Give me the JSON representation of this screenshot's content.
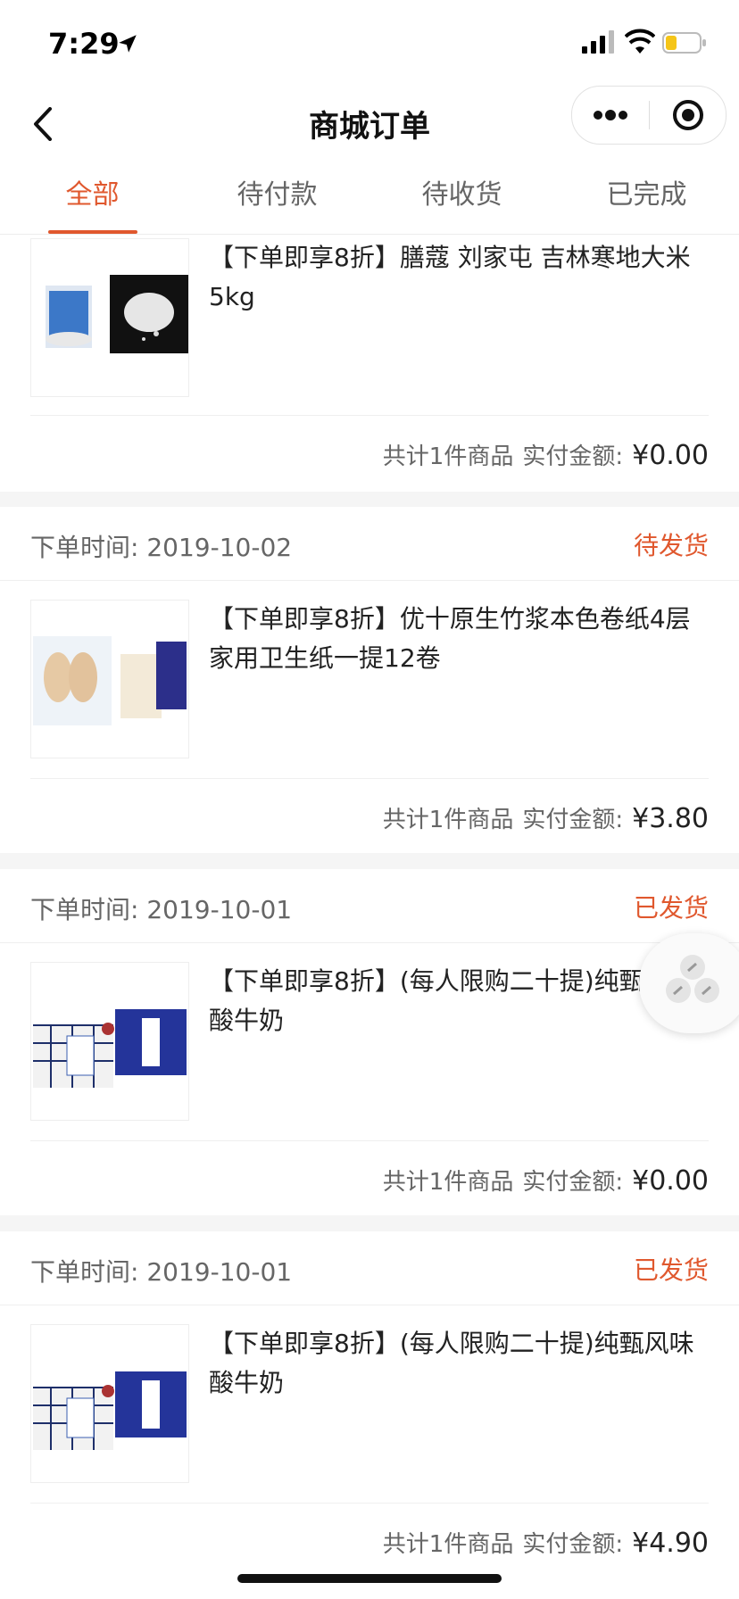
{
  "status": {
    "time": "7:29"
  },
  "nav": {
    "title": "商城订单"
  },
  "tabs": [
    {
      "label": "全部",
      "active": true
    },
    {
      "label": "待付款",
      "active": false
    },
    {
      "label": "待收货",
      "active": false
    },
    {
      "label": "已完成",
      "active": false
    }
  ],
  "orders": [
    {
      "date_label": "",
      "date": "",
      "status": "",
      "product_title": "【下单即享8折】膳蔻 刘家屯 吉林寒地大米5kg",
      "summary_count": "共计1件商品",
      "summary_paid_label": "实付金额:",
      "summary_amount": "¥0.00"
    },
    {
      "date_label": "下单时间:",
      "date": "2019-10-02",
      "status": "待发货",
      "product_title": "【下单即享8折】优十原生竹浆本色卷纸4层家用卫生纸一提12卷",
      "summary_count": "共计1件商品",
      "summary_paid_label": "实付金额:",
      "summary_amount": "¥3.80"
    },
    {
      "date_label": "下单时间:",
      "date": "2019-10-01",
      "status": "已发货",
      "product_title": "【下单即享8折】(每人限购二十提)纯甄风味酸牛奶",
      "summary_count": "共计1件商品",
      "summary_paid_label": "实付金额:",
      "summary_amount": "¥0.00"
    },
    {
      "date_label": "下单时间:",
      "date": "2019-10-01",
      "status": "已发货",
      "product_title": "【下单即享8折】(每人限购二十提)纯甄风味酸牛奶",
      "summary_count": "共计1件商品",
      "summary_paid_label": "实付金额:",
      "summary_amount": "¥4.90"
    }
  ],
  "colors": {
    "accent": "#e0582e"
  },
  "icons": [
    "location-arrow-icon",
    "signal-icon",
    "wifi-icon",
    "battery-icon",
    "back-chevron-icon",
    "more-dots-icon",
    "close-target-icon",
    "share-link-icon"
  ]
}
